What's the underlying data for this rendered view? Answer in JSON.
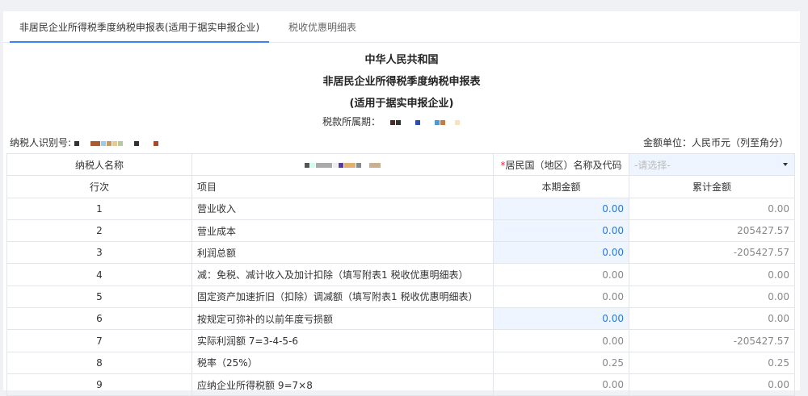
{
  "tabs": [
    {
      "label": "非居民企业所得税季度纳税申报表(适用于据实申报企业)",
      "active": true
    },
    {
      "label": "税收优惠明细表",
      "active": false
    }
  ],
  "header": {
    "line1": "中华人民共和国",
    "line2": "非居民企业所得税季度纳税申报表",
    "line3": "(适用于据实申报企业)",
    "period_label": "税款所属期："
  },
  "taxpayer_id_label": "纳税人识别号:",
  "unit_label": "金额单位：人民币元（列至角分）",
  "name_row": {
    "label": "纳税人名称",
    "country_label": "居民国（地区）名称及代码",
    "country_placeholder": "-请选择-"
  },
  "columns": [
    "行次",
    "项目",
    "本期金额",
    "累计金额"
  ],
  "rows": [
    {
      "no": "1",
      "item": "营业收入",
      "current": "0.00",
      "cumulative": "0.00",
      "editable": true
    },
    {
      "no": "2",
      "item": "营业成本",
      "current": "0.00",
      "cumulative": "205427.57",
      "editable": true
    },
    {
      "no": "3",
      "item": "利润总额",
      "current": "0.00",
      "cumulative": "-205427.57",
      "editable": true
    },
    {
      "no": "4",
      "item": "减：免税、减计收入及加计扣除（填写附表1 税收优惠明细表）",
      "current": "0.00",
      "cumulative": "0.00",
      "editable": false
    },
    {
      "no": "5",
      "item": "固定资产加速折旧（扣除）调减额（填写附表1 税收优惠明细表）",
      "current": "0.00",
      "cumulative": "0.00",
      "editable": false
    },
    {
      "no": "6",
      "item": "按规定可弥补的以前年度亏损额",
      "current": "0.00",
      "cumulative": "0.00",
      "editable": true
    },
    {
      "no": "7",
      "item": "实际利润额 7=3-4-5-6",
      "current": "0.00",
      "cumulative": "-205427.57",
      "editable": false
    },
    {
      "no": "8",
      "item": "税率（25%）",
      "current": "0.25",
      "cumulative": "0.25",
      "editable": false
    },
    {
      "no": "9",
      "item": "应纳企业所得税额 9=7×8",
      "current": "0.00",
      "cumulative": "0.00",
      "editable": false
    }
  ],
  "colors": {
    "accent": "#3b82f6",
    "editable_bg": "#eef5fe",
    "editable_text": "#2a7ad6"
  }
}
